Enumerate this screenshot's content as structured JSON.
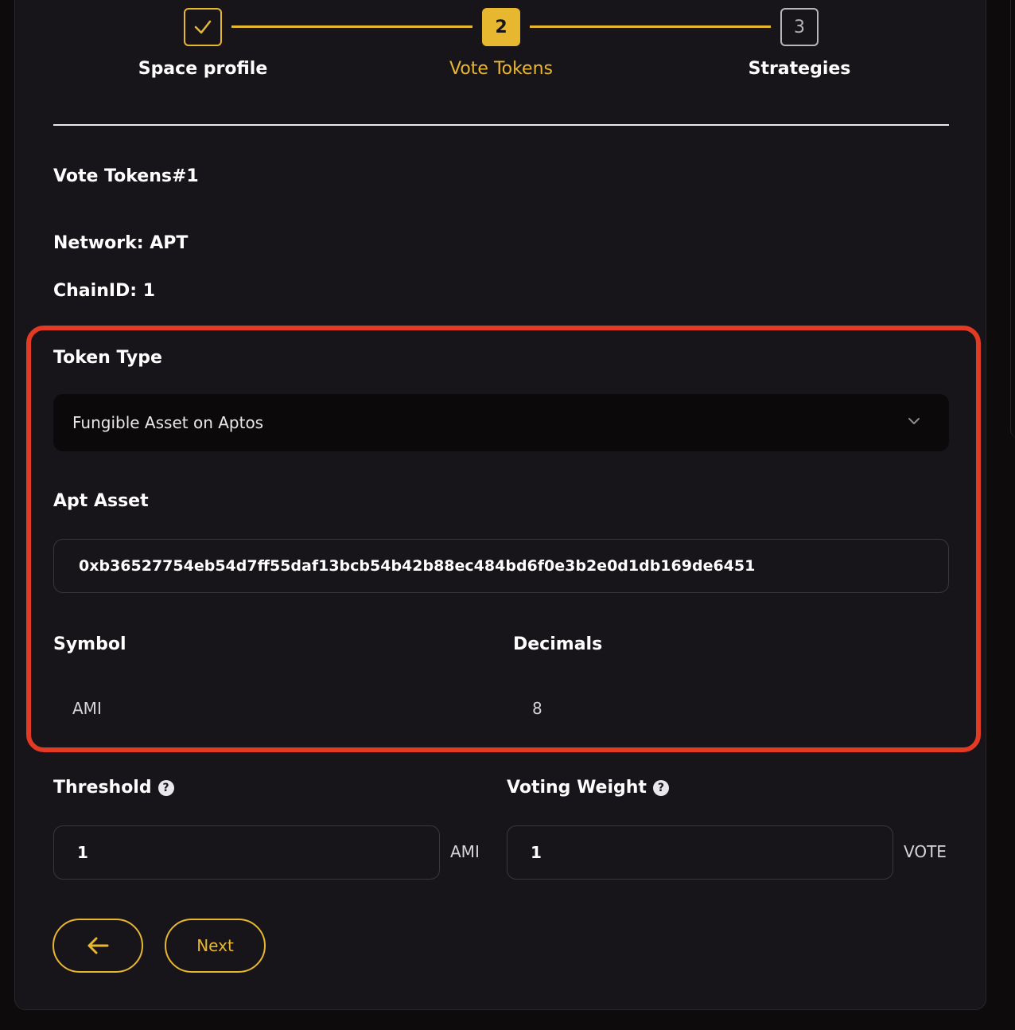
{
  "stepper": {
    "steps": [
      {
        "number": "",
        "label": "Space profile",
        "state": "completed",
        "icon": "check-icon"
      },
      {
        "number": "2",
        "label": "Vote Tokens",
        "state": "active"
      },
      {
        "number": "3",
        "label": "Strategies",
        "state": "upcoming"
      }
    ]
  },
  "section": {
    "title": "Vote Tokens#1",
    "network": "Network: APT",
    "chain_id": "ChainID: 1"
  },
  "token_type": {
    "label": "Token Type",
    "selected": "Fungible Asset on Aptos",
    "icon": "chevron-down-icon"
  },
  "apt_asset": {
    "label": "Apt Asset",
    "value": "0xb36527754eb54d7ff55daf13bcb54b42b88ec484bd6f0e3b2e0d1db169de6451"
  },
  "symbol": {
    "label": "Symbol",
    "value": "AMI"
  },
  "decimals": {
    "label": "Decimals",
    "value": "8"
  },
  "threshold": {
    "label": "Threshold",
    "value": "1",
    "unit": "AMI",
    "help": "?"
  },
  "voting_weight": {
    "label": "Voting Weight",
    "value": "1",
    "unit": "VOTE",
    "help": "?"
  },
  "actions": {
    "back_icon": "arrow-left-icon",
    "next_label": "Next"
  },
  "colors": {
    "accent": "#e8b730",
    "highlight": "#e33a24",
    "card_bg": "#18151a",
    "page_bg": "#0d0b0c"
  }
}
